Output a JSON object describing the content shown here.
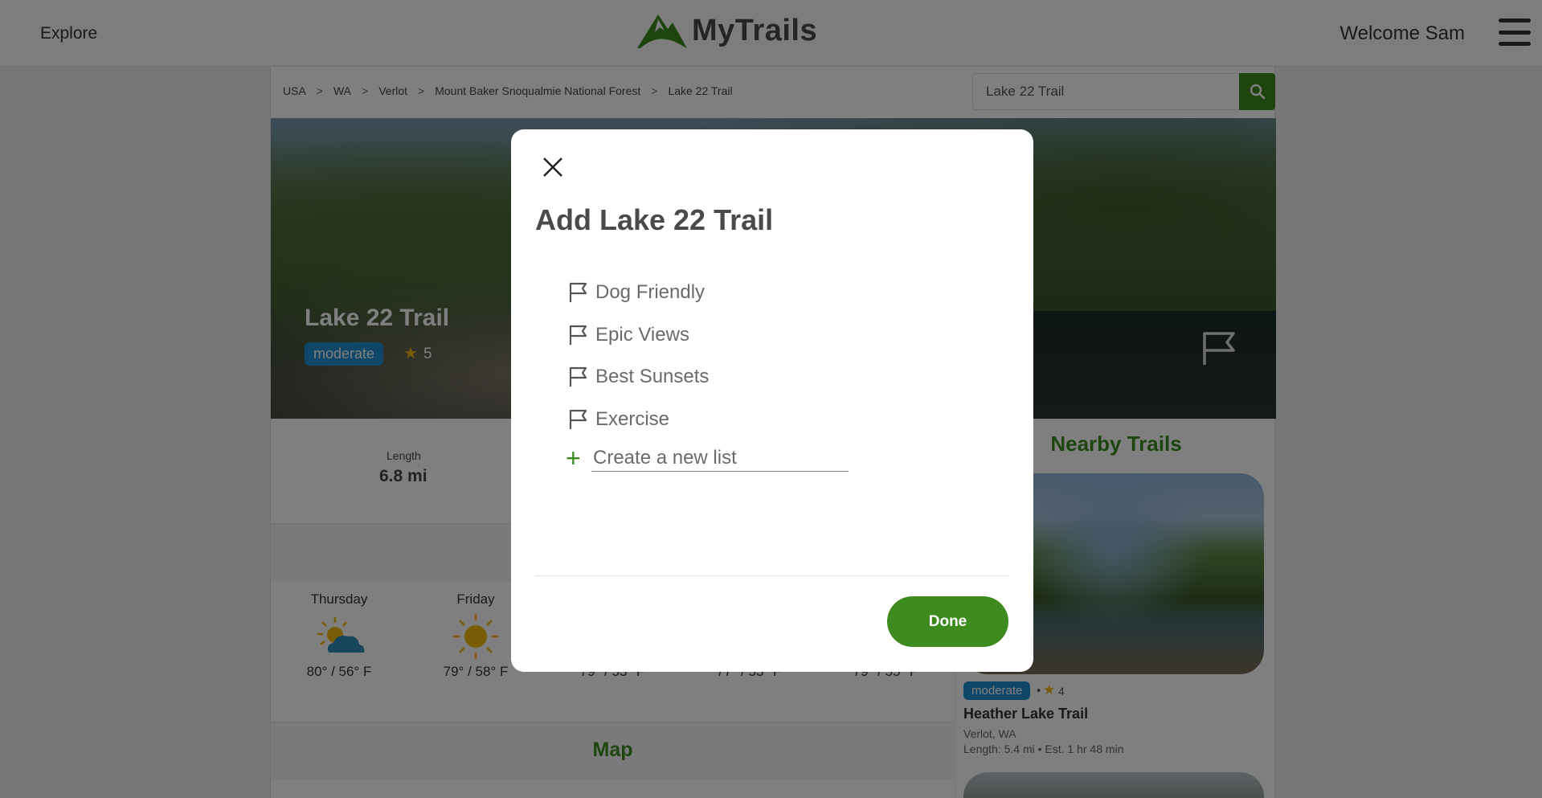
{
  "header": {
    "explore_label": "Explore",
    "logo_text": "MyTrails",
    "welcome_text": "Welcome Sam",
    "brand_color": "#3d8b1e"
  },
  "breadcrumb": [
    "USA",
    "WA",
    "Verlot",
    "Mount Baker Snoqualmie National Forest",
    "Lake 22 Trail"
  ],
  "breadcrumb_separator": ">",
  "search": {
    "value": "Lake 22 Trail"
  },
  "trail": {
    "name": "Lake 22 Trail",
    "difficulty": "moderate",
    "rating": "5",
    "length_label": "Length",
    "length_value": "6.8 mi"
  },
  "weather": [
    {
      "day": "Thursday",
      "temp": "80° / 56° F",
      "icon": "partly-cloudy-icon"
    },
    {
      "day": "Friday",
      "temp": "79° / 58° F",
      "icon": "sun-icon"
    },
    {
      "day": "",
      "temp": "79° / 53° F",
      "icon": "sun-icon"
    },
    {
      "day": "",
      "temp": "77° / 53° F",
      "icon": "sun-icon"
    },
    {
      "day": "",
      "temp": "79° / 55° F",
      "icon": "sun-icon"
    }
  ],
  "map_title": "Map",
  "nearby": {
    "title": "Nearby Trails",
    "trails": [
      {
        "difficulty": "moderate",
        "separator": "•",
        "rating": "4",
        "name": "Heather Lake Trail",
        "location": "Verlot, WA",
        "meta": "Length: 5.4 mi • Est. 1 hr 48 min"
      }
    ]
  },
  "modal": {
    "title": "Add Lake 22 Trail",
    "lists": [
      "Dog Friendly",
      "Epic Views",
      "Best Sunsets",
      "Exercise"
    ],
    "create_placeholder": "Create a new list",
    "done_label": "Done"
  }
}
